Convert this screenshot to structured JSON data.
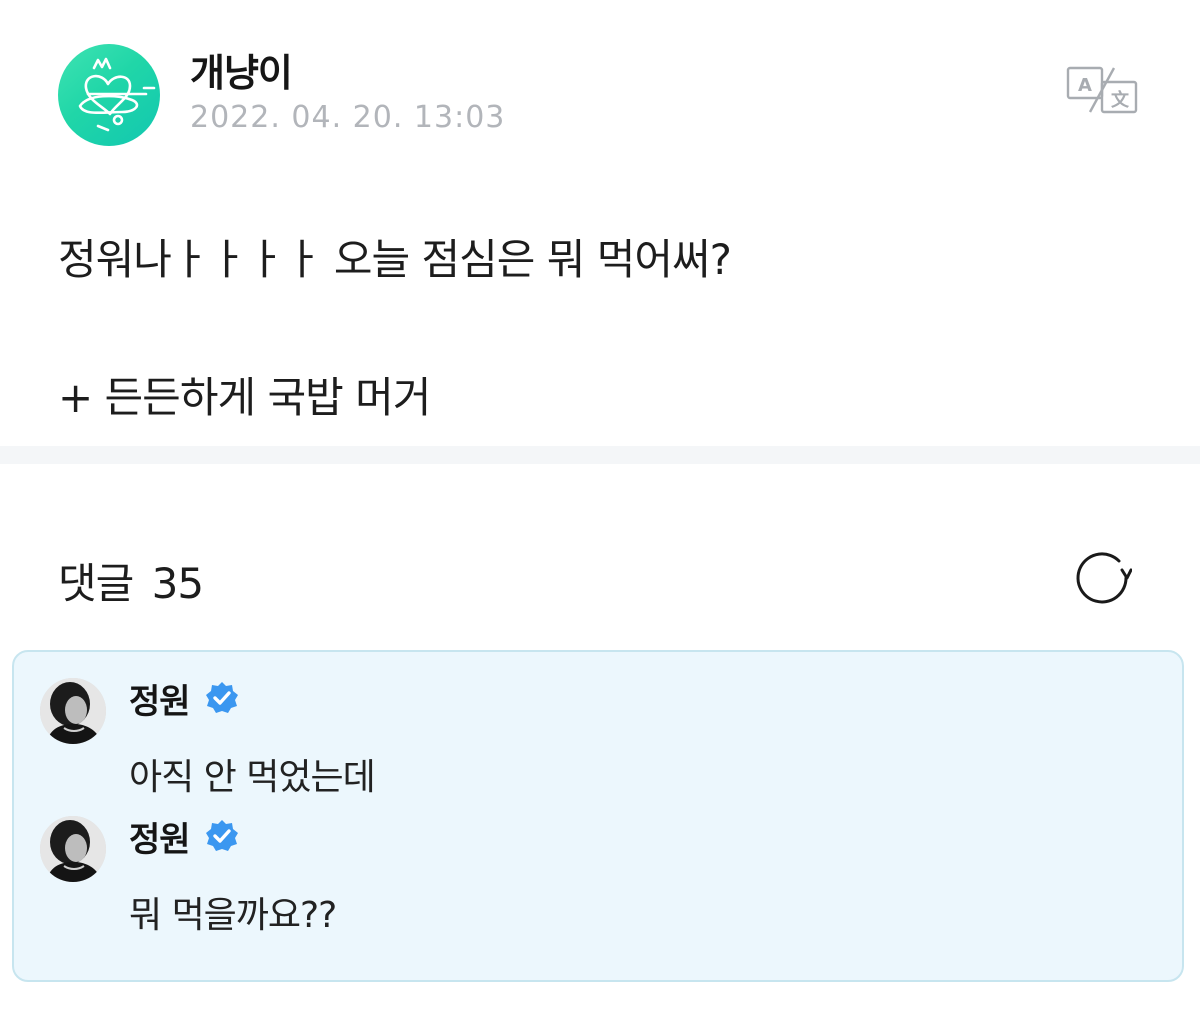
{
  "post": {
    "author": "개냥이",
    "timestamp": "2022. 04. 20. 13:03",
    "body_line1": "정워나ㅏㅏㅏㅏ 오늘 점심은 뭐 먹어써?",
    "body_line2": "+ 든든하게 국밥 머거",
    "avatar_icon": "heart-doodle-icon",
    "accent_color": "#20d6a8"
  },
  "toolbar": {
    "translate_icon": "translate-icon"
  },
  "comments": {
    "label": "댓글",
    "count": "35",
    "refresh_icon": "refresh-icon",
    "highlight_bg": "#ecf7fd",
    "replies": [
      {
        "author": "정원",
        "verified": true,
        "text": "아직 안 먹었는데"
      },
      {
        "author": "정원",
        "verified": true,
        "text": "뭐 먹을까요??"
      }
    ]
  },
  "colors": {
    "verified_badge": "#3b97f0",
    "muted_text": "#b2b5ba",
    "divider": "#f4f6f8"
  }
}
